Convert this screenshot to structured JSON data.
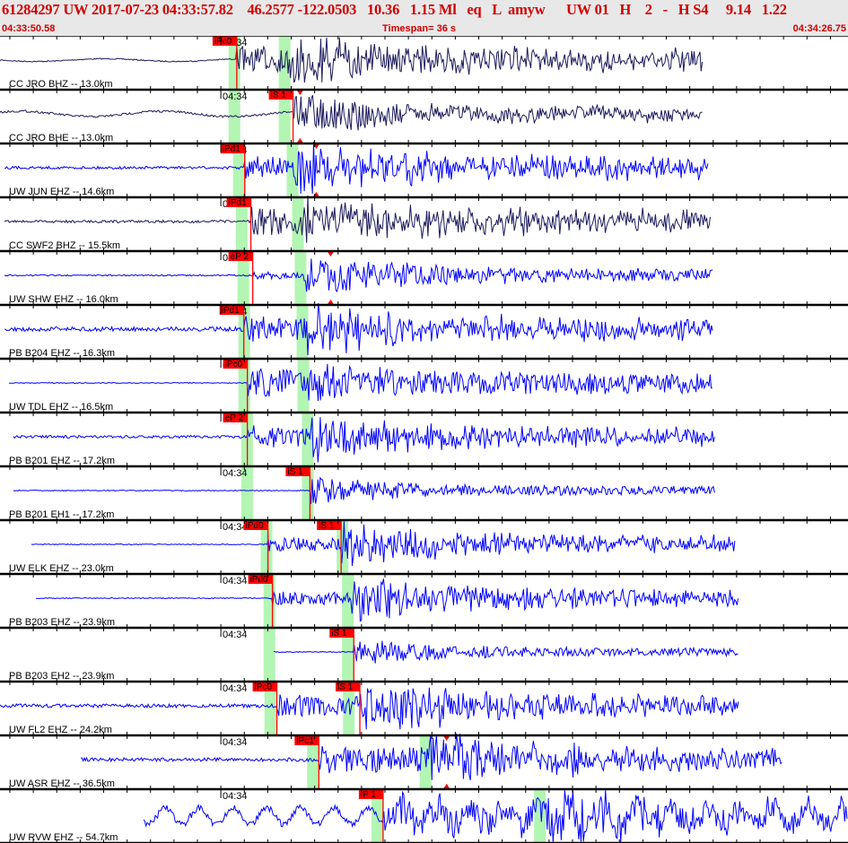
{
  "header": {
    "title": "61284297 UW 2017-07-23 04:33:57.82    46.2577 -122.0503   10.36   1.15 Ml   eq   L  amyw      UW 01   H    2   -   H S4     9.14   1.22",
    "start_time": "04:33:50.58",
    "timespan": "Timespan=  36 s",
    "end_time": "04:34:26.75"
  },
  "colors": {
    "header_text": "#d00000",
    "pick": "#ff0000",
    "window": "#b3f5b3",
    "trace_broadband": "#1c1a5c",
    "trace_short_period": "#0000ff"
  },
  "chart_data": {
    "type": "line",
    "title": "",
    "x_axis": {
      "range": [
        "04:33:50.58",
        "04:34:26.75"
      ],
      "tick_interval_s": 1,
      "major_label": "04:34"
    },
    "rows": [
      {
        "label": "CC JRO BHZ -- 13.0km",
        "color": "#1c1a5c",
        "picks": [
          {
            "label": "iPc0",
            "time": "04:34:00.68"
          }
        ],
        "peaks": [],
        "windows": [
          "04:34:00.33",
          "04:34:02.47"
        ]
      },
      {
        "label": "CC JRO BHE -- 13.0km",
        "color": "#1c1a5c",
        "picks": [
          {
            "label": "iS 1",
            "time": "04:34:03.08"
          }
        ],
        "peaks": [
          "04:34:03.38"
        ],
        "windows": [
          "04:34:00.33",
          "04:34:02.47"
        ]
      },
      {
        "label": "UW JUN EHZ -- 14.6km",
        "color": "#0000ff",
        "picks": [
          {
            "label": "iPd1",
            "time": "04:34:01.02"
          }
        ],
        "peaks": [
          "04:34:04.07"
        ],
        "windows": [
          "04:34:00.52",
          "04:34:02.81"
        ]
      },
      {
        "label": "CC SWF2 BHZ -- 15.5km",
        "color": "#1c1a5c",
        "picks": [
          {
            "label": "iPd1",
            "time": "04:34:01.28"
          }
        ],
        "peaks": [],
        "windows": [
          "04:34:00.64",
          "04:34:03.04"
        ]
      },
      {
        "label": "UW SHW EHZ -- 16.0km",
        "color": "#0000ff",
        "picks": [
          {
            "label": "eP 2",
            "time": "04:34:01.36"
          }
        ],
        "peaks": [
          "04:34:04.68"
        ],
        "windows": [
          "04:34:00.71",
          "04:34:03.15"
        ]
      },
      {
        "label": "PB B204 EHZ -- 16.3km",
        "color": "#0000ff",
        "picks": [
          {
            "label": "iPd1",
            "time": "04:34:00.98"
          }
        ],
        "peaks": [],
        "windows": [
          "04:34:00.75",
          "04:34:03.23"
        ]
      },
      {
        "label": "UW TDL EHZ -- 16.5km",
        "color": "#0000ff",
        "picks": [
          {
            "label": "iPc0",
            "time": "04:34:01.13"
          }
        ],
        "peaks": [],
        "windows": [
          "04:34:00.75",
          "04:34:03.27"
        ]
      },
      {
        "label": "PB B201 EHZ -- 17.2km",
        "color": "#0000ff",
        "picks": [
          {
            "label": "eP 2",
            "time": "04:34:01.13"
          }
        ],
        "peaks": [],
        "windows": [
          "04:34:00.87",
          "04:34:03.46"
        ]
      },
      {
        "label": "PB B201 EH1 -- 17.2km",
        "color": "#0000ff",
        "picks": [
          {
            "label": "iS 1",
            "time": "04:34:03.80"
          }
        ],
        "peaks": [],
        "windows": [
          "04:34:00.87",
          "04:34:03.46"
        ]
      },
      {
        "label": "UW ELK EHZ -- 23.0km",
        "color": "#0000ff",
        "picks": [
          {
            "label": "iPd0",
            "time": "04:34:02.01"
          },
          {
            "label": "iS 1",
            "time": "04:34:05.13"
          }
        ],
        "peaks": [],
        "windows": [
          "04:34:01.70",
          "04:34:04.94"
        ]
      },
      {
        "label": "PB B203 EHZ -- 23.9km",
        "color": "#0000ff",
        "picks": [
          {
            "label": "iPd0",
            "time": "04:34:02.20"
          }
        ],
        "peaks": [],
        "windows": [
          "04:34:01.82",
          "04:34:05.17"
        ]
      },
      {
        "label": "PB B203 EH2 -- 23.9km",
        "color": "#0000ff",
        "picks": [
          {
            "label": "iS 1",
            "time": "04:34:05.67"
          }
        ],
        "peaks": [],
        "windows": [
          "04:34:01.82",
          "04:34:05.17"
        ]
      },
      {
        "label": "UW FL2 EHZ -- 24.2km",
        "color": "#0000ff",
        "picks": [
          {
            "label": "iPc0",
            "time": "04:34:02.39"
          },
          {
            "label": "iS 1",
            "time": "04:34:05.93"
          }
        ],
        "peaks": [],
        "windows": [
          "04:34:01.86",
          "04:34:05.21"
        ]
      },
      {
        "label": "UW ASR EHZ -- 36.5km",
        "color": "#0000ff",
        "picks": [
          {
            "label": "iPc1",
            "time": "04:34:04.18"
          }
        ],
        "peaks": [
          "04:34:09.63"
        ],
        "windows": [
          "04:34:03.68",
          "04:34:08.48"
        ]
      },
      {
        "label": "UW RVW EHZ -- 54.7km",
        "color": "#0000ff",
        "picks": [
          {
            "label": "iP 1",
            "time": "04:34:06.92"
          }
        ],
        "peaks": [],
        "windows": [
          "04:34:06.43",
          "04:34:13.36"
        ]
      }
    ]
  }
}
